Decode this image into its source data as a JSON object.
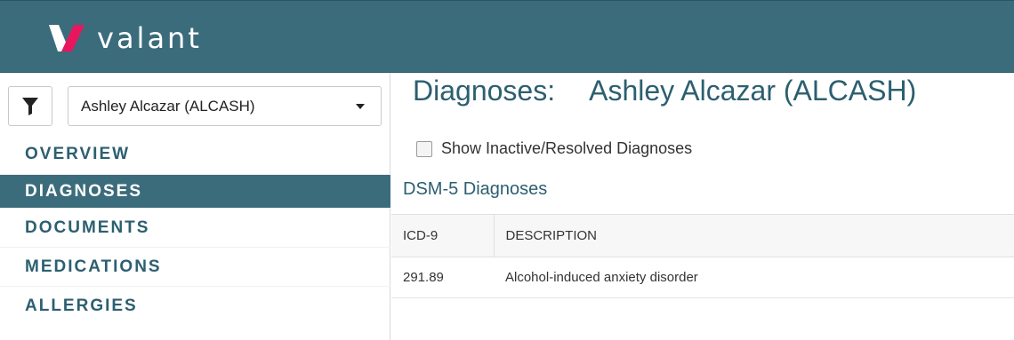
{
  "header": {
    "logo_text": "valant",
    "logo_color": "#e8175d"
  },
  "sidebar": {
    "filter_icon": "filter-icon",
    "patient_select_value": "Ashley Alcazar (ALCASH)",
    "nav_items": [
      {
        "label": "OVERVIEW",
        "active": false
      },
      {
        "label": "DIAGNOSES",
        "active": true
      },
      {
        "label": "DOCUMENTS",
        "active": false
      },
      {
        "label": "MEDICATIONS",
        "active": false
      },
      {
        "label": "ALLERGIES",
        "active": false
      }
    ]
  },
  "main": {
    "title_prefix": "Diagnoses:",
    "title_patient": "Ashley Alcazar (ALCASH)",
    "show_inactive_label": "Show Inactive/Resolved Diagnoses",
    "show_inactive_checked": false,
    "section_title": "DSM-5 Diagnoses",
    "table": {
      "headers": [
        "ICD-9",
        "DESCRIPTION"
      ],
      "rows": [
        {
          "code": "291.89",
          "description": "Alcohol-induced anxiety disorder"
        }
      ]
    }
  },
  "colors": {
    "brand_teal": "#3b6c7b",
    "title_teal": "#2c5f70"
  }
}
